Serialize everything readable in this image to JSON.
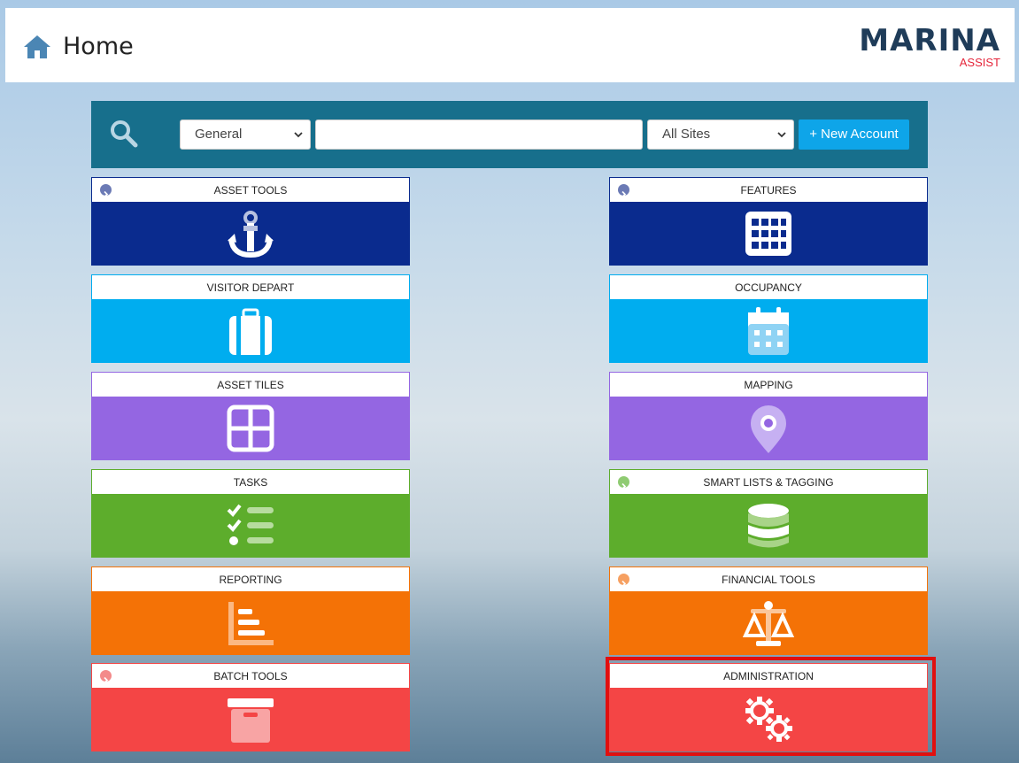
{
  "header": {
    "title": "Home",
    "logo_main": "MARINA",
    "logo_sub": "ASSIST"
  },
  "search": {
    "category_selected": "General",
    "query_value": "",
    "sites_selected": "All Sites",
    "new_account_label": "+ New Account"
  },
  "tiles": [
    {
      "label": "ASSET TOOLS",
      "color": "#0a2b8e",
      "icon": "anchor-icon",
      "expand": true,
      "arrow_color": "#6b7ab5"
    },
    {
      "label": "FEATURES",
      "color": "#0a2b8e",
      "icon": "grid-icon",
      "expand": true,
      "arrow_color": "#6b7ab5"
    },
    {
      "label": "VISITOR DEPART",
      "color": "#00adef",
      "icon": "suitcase-icon",
      "expand": false
    },
    {
      "label": "OCCUPANCY",
      "color": "#00adef",
      "icon": "calendar-icon",
      "expand": false
    },
    {
      "label": "ASSET TILES",
      "color": "#9466e2",
      "icon": "tiles-icon",
      "expand": false
    },
    {
      "label": "MAPPING",
      "color": "#9466e2",
      "icon": "map-pin-icon",
      "expand": false
    },
    {
      "label": "TASKS",
      "color": "#5dad2c",
      "icon": "checklist-icon",
      "expand": false
    },
    {
      "label": "SMART LISTS & TAGGING",
      "color": "#5dad2c",
      "icon": "database-icon",
      "expand": true,
      "arrow_color": "#8fcb72"
    },
    {
      "label": "REPORTING",
      "color": "#f47206",
      "icon": "bar-chart-icon",
      "expand": false
    },
    {
      "label": "FINANCIAL TOOLS",
      "color": "#f47206",
      "icon": "scales-icon",
      "expand": true,
      "arrow_color": "#f6a061"
    },
    {
      "label": "BATCH TOOLS",
      "color": "#f44545",
      "icon": "archive-icon",
      "expand": true,
      "arrow_color": "#f38a8a"
    },
    {
      "label": "ADMINISTRATION",
      "color": "#f44545",
      "icon": "gears-icon",
      "expand": false
    }
  ]
}
